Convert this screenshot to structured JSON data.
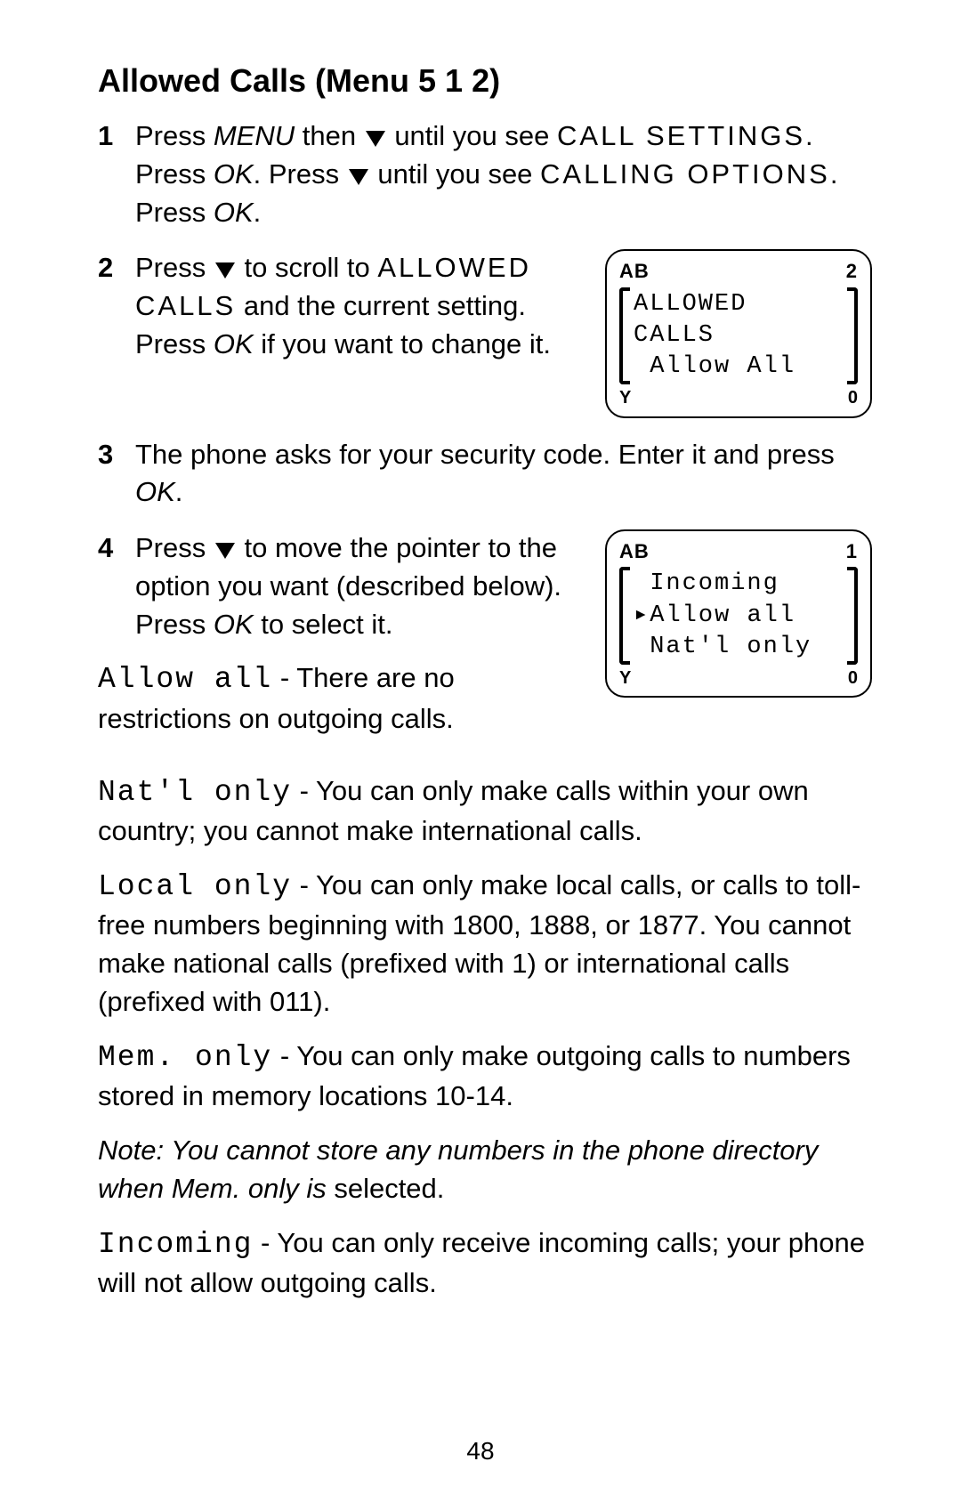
{
  "title": "Allowed Calls (Menu 5 1 2)",
  "steps": {
    "s1": {
      "num": "1",
      "t1": "Press ",
      "menu": "MENU",
      "t2": " then ",
      "t3": " until you see ",
      "scr1": "CALL SETTINGS",
      "t4": ". Press ",
      "ok1": "OK",
      "t5": ". Press ",
      "t6": " until you see ",
      "scr2": "CALLING OPTIONS",
      "t7": ". Press ",
      "ok2": "OK",
      "t8": "."
    },
    "s2": {
      "num": "2",
      "t1": "Press ",
      "t2": " to scroll to ",
      "scr": "ALLOWED CALLS",
      "t3": " and the current setting. Press ",
      "ok": "OK",
      "t4": " if you want to change it."
    },
    "s3": {
      "num": "3",
      "t1": "The phone asks for your security code. Enter it and press ",
      "ok": "OK",
      "t2": "."
    },
    "s4": {
      "num": "4",
      "t1": "Press ",
      "t2": " to move the pointer to the option you want (described below). Press ",
      "ok": "OK",
      "t3": " to select it."
    }
  },
  "screen1": {
    "hdr_left": "AB",
    "hdr_right": "2",
    "line1": "ALLOWED",
    "line2": "CALLS",
    "line3": " Allow All",
    "ftr_left": "Y",
    "ftr_right": "0"
  },
  "screen2": {
    "hdr_left": "AB",
    "hdr_right": "1",
    "line1": " Incoming",
    "line2": "▸Allow all",
    "line3": " Nat'l only",
    "ftr_left": "Y",
    "ftr_right": "0"
  },
  "opt_allow": {
    "label": "Allow all",
    "desc": " - There are no restrictions on outgoing calls."
  },
  "opt_natl": {
    "label": "Nat'l only",
    "desc": " - You can only make calls within your own country; you cannot make international calls."
  },
  "opt_local": {
    "label": "Local only",
    "desc": " - You can only make local calls, or calls to toll-free numbers beginning with 1800, 1888, or 1877. You cannot make national calls (prefixed with 1) or international calls (prefixed with 011)."
  },
  "opt_mem": {
    "label": "Mem. only",
    "desc": " - You can only make outgoing calls to numbers stored in memory locations 10-14."
  },
  "note": {
    "t1": "Note: You cannot store any numbers in the phone directory when Mem. only is ",
    "t2": "selected."
  },
  "opt_incoming": {
    "label": "Incoming",
    "desc": " - You can only receive incoming calls; your phone will not allow outgoing calls."
  },
  "page_number": "48"
}
